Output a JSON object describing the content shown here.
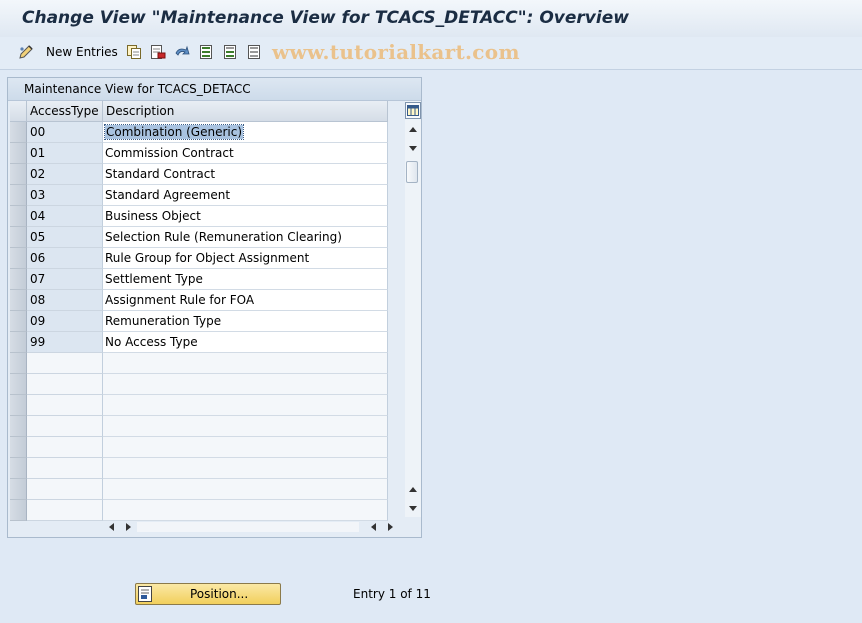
{
  "window": {
    "title": "Change View \"Maintenance View for TCACS_DETACC\": Overview"
  },
  "toolbar": {
    "new_entries_label": "New Entries",
    "icons": [
      "edit-pencil-icon",
      "copy-icon",
      "delete-icon",
      "undo-icon",
      "select-all-icon",
      "select-block-icon",
      "deselect-all-icon"
    ]
  },
  "watermark": "www.tutorialkart.com",
  "table": {
    "panel_title": "Maintenance View for TCACS_DETACC",
    "columns": [
      "AccessType",
      "Description"
    ],
    "rows": [
      {
        "key": "00",
        "description": "Combination (Generic)"
      },
      {
        "key": "01",
        "description": "Commission Contract"
      },
      {
        "key": "02",
        "description": "Standard Contract"
      },
      {
        "key": "03",
        "description": "Standard Agreement"
      },
      {
        "key": "04",
        "description": "Business Object"
      },
      {
        "key": "05",
        "description": "Selection Rule (Remuneration Clearing)"
      },
      {
        "key": "06",
        "description": "Rule Group for Object Assignment"
      },
      {
        "key": "07",
        "description": "Settlement Type"
      },
      {
        "key": "08",
        "description": "Assignment Rule for FOA"
      },
      {
        "key": "09",
        "description": "Remuneration Type"
      },
      {
        "key": "99",
        "description": "No Access Type"
      }
    ],
    "empty_rows": 8
  },
  "footer": {
    "position_button_label": "Position...",
    "entry_info": "Entry 1 of 11"
  },
  "colors": {
    "background": "#dfe9f5",
    "key_column": "#dce6f1",
    "highlight": "#a9c3e0",
    "button_yellow": "#f1cf5c",
    "watermark": "#eac28c"
  }
}
